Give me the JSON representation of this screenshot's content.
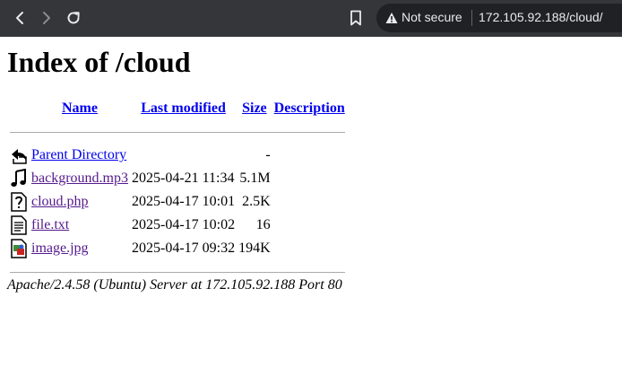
{
  "browser": {
    "security_label": "Not secure",
    "url": "172.105.92.188/cloud/",
    "icons": [
      "back-icon",
      "forward-icon",
      "reload-icon",
      "bookmark-icon",
      "warning-icon"
    ]
  },
  "page": {
    "title": "Index of /cloud",
    "columns": {
      "name": "Name",
      "last_modified": "Last modified",
      "size": "Size",
      "description": "Description"
    },
    "entries": [
      {
        "icon": "back-folder-icon",
        "name": "Parent Directory",
        "modified": "",
        "size": "-",
        "description": "",
        "visited": false
      },
      {
        "icon": "audio-file-icon",
        "name": "background.mp3",
        "modified": "2025-04-21 11:34",
        "size": "5.1M",
        "description": "",
        "visited": true
      },
      {
        "icon": "unknown-file-icon",
        "name": "cloud.php",
        "modified": "2025-04-17 10:01",
        "size": "2.5K",
        "description": "",
        "visited": true
      },
      {
        "icon": "text-file-icon",
        "name": "file.txt",
        "modified": "2025-04-17 10:02",
        "size": "16",
        "description": "",
        "visited": true
      },
      {
        "icon": "image-file-icon",
        "name": "image.jpg",
        "modified": "2025-04-17 09:32",
        "size": "194K",
        "description": "",
        "visited": true
      }
    ],
    "footer": "Apache/2.4.58 (Ubuntu) Server at 172.105.92.188 Port 80"
  }
}
